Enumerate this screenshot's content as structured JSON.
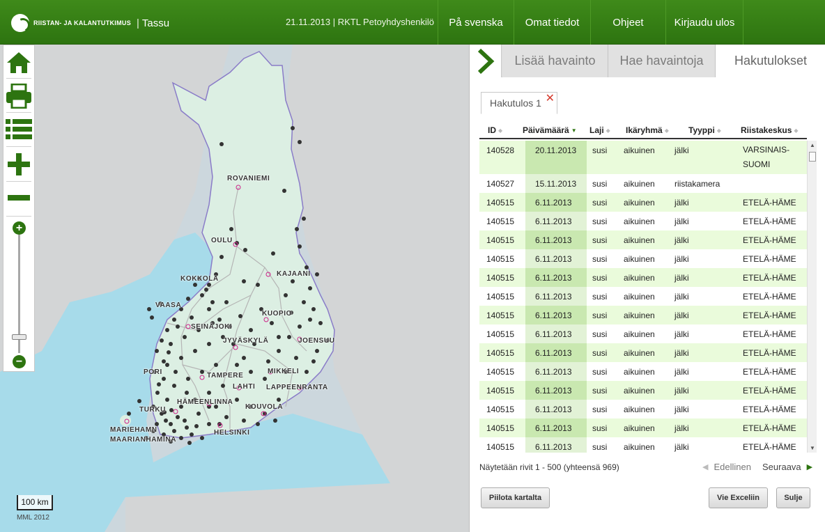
{
  "header": {
    "logo_text": "RIISTAN- JA KALANTUTKIMUS",
    "separator": "|",
    "app_name": "Tassu",
    "status": "21.11.2013 | RKTL Petoyhdyshenkilö",
    "nav": [
      {
        "label": "På svenska"
      },
      {
        "label": "Omat tiedot"
      },
      {
        "label": "Ohjeet"
      },
      {
        "label": "Kirjaudu ulos"
      }
    ],
    "brand_color": "#2d7410"
  },
  "map": {
    "cities": [
      "ROVANIEMI",
      "OULU",
      "KOKKOLA",
      "KAJAANI",
      "VAASA",
      "SEINÄJOKI",
      "KUOPIO",
      "JYVÄSKYLÄ",
      "JOENSUU",
      "PORI",
      "TAMPERE",
      "MIKKELI",
      "LAHTI",
      "LAPPEENRANTA",
      "HÄMEENLINNA",
      "TURKU",
      "KOUVOLA",
      "MARIEHAMN",
      "MAARIANHAMINA",
      "HELSINKI"
    ],
    "scale_label": "100 km",
    "attribution": "MML 2012",
    "tools": [
      "home-icon",
      "print-icon",
      "list-icon",
      "plus-icon",
      "minus-icon"
    ]
  },
  "panel": {
    "tabs": [
      {
        "label": "Lisää havainto"
      },
      {
        "label": "Hae havaintoja"
      },
      {
        "label": "Hakutulokset"
      }
    ],
    "active_tab": "Hakutulokset",
    "result_tab": {
      "label": "Hakutulos 1",
      "close": "✕"
    },
    "table": {
      "columns": [
        "ID",
        "Päivämäärä",
        "Laji",
        "Ikäryhmä",
        "Tyyppi",
        "Riistakeskus"
      ],
      "sorted_column": "Päivämäärä",
      "sort_direction": "descending",
      "rows": [
        [
          "140528",
          "20.11.2013",
          "susi",
          "aikuinen",
          "jälki",
          "VARSINAIS-SUOMI"
        ],
        [
          "140527",
          "15.11.2013",
          "susi",
          "aikuinen",
          "riistakamera",
          ""
        ],
        [
          "140515",
          "6.11.2013",
          "susi",
          "aikuinen",
          "jälki",
          "ETELÄ-HÄME"
        ],
        [
          "140515",
          "6.11.2013",
          "susi",
          "aikuinen",
          "jälki",
          "ETELÄ-HÄME"
        ],
        [
          "140515",
          "6.11.2013",
          "susi",
          "aikuinen",
          "jälki",
          "ETELÄ-HÄME"
        ],
        [
          "140515",
          "6.11.2013",
          "susi",
          "aikuinen",
          "jälki",
          "ETELÄ-HÄME"
        ],
        [
          "140515",
          "6.11.2013",
          "susi",
          "aikuinen",
          "jälki",
          "ETELÄ-HÄME"
        ],
        [
          "140515",
          "6.11.2013",
          "susi",
          "aikuinen",
          "jälki",
          "ETELÄ-HÄME"
        ],
        [
          "140515",
          "6.11.2013",
          "susi",
          "aikuinen",
          "jälki",
          "ETELÄ-HÄME"
        ],
        [
          "140515",
          "6.11.2013",
          "susi",
          "aikuinen",
          "jälki",
          "ETELÄ-HÄME"
        ],
        [
          "140515",
          "6.11.2013",
          "susi",
          "aikuinen",
          "jälki",
          "ETELÄ-HÄME"
        ],
        [
          "140515",
          "6.11.2013",
          "susi",
          "aikuinen",
          "jälki",
          "ETELÄ-HÄME"
        ],
        [
          "140515",
          "6.11.2013",
          "susi",
          "aikuinen",
          "jälki",
          "ETELÄ-HÄME"
        ],
        [
          "140515",
          "6.11.2013",
          "susi",
          "aikuinen",
          "jälki",
          "ETELÄ-HÄME"
        ],
        [
          "140515",
          "6.11.2013",
          "susi",
          "aikuinen",
          "jälki",
          "ETELÄ-HÄME"
        ],
        [
          "140515",
          "6.11.2013",
          "susi",
          "aikuinen",
          "jälki",
          "ETELÄ-HÄME"
        ]
      ]
    },
    "pager": {
      "info": "Näytetään rivit 1 - 500 (yhteensä 969)",
      "prev": "Edellinen",
      "next": "Seuraava"
    },
    "buttons": {
      "hide_map": "Piilota kartalta",
      "export_excel": "Vie Exceliin",
      "close": "Sulje"
    }
  }
}
